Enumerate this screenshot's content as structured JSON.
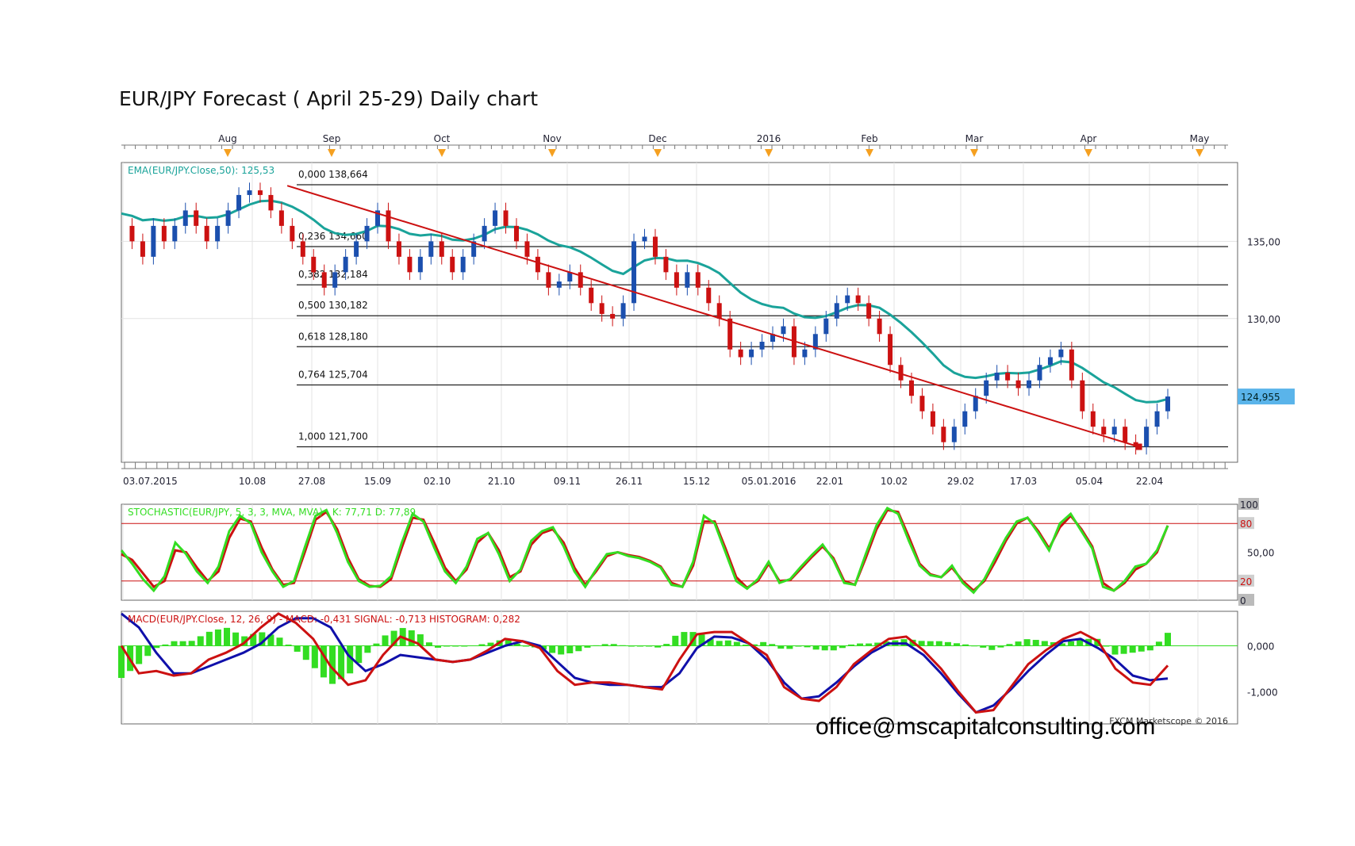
{
  "title": "EUR/JPY Forecast ( April 25-29) Daily chart",
  "email": "office@mscapitalconsulting.com",
  "credit": "FXCM Marketscope © 2016",
  "colors": {
    "ema": "#1aa39a",
    "trend": "#cc1111",
    "bull": "#1b4fae",
    "bear": "#cc1111",
    "stoch_k": "#33dd22",
    "stoch_d": "#cc1111",
    "macd": "#cc1111",
    "signal": "#1010aa",
    "hist": "#33dd22",
    "price_tag": "#5ab4ea",
    "month_marker": "#f5a020"
  },
  "chart_data": [
    {
      "type": "candlestick",
      "title": "EUR/JPY Forecast ( April 25-29) Daily chart",
      "ema_label": "EMA(EUR/JPY.Close,50): 125,53",
      "month_labels": [
        "Aug",
        "Sep",
        "Oct",
        "Nov",
        "Dec",
        "2016",
        "Feb",
        "Mar",
        "Apr",
        "May"
      ],
      "date_labels": [
        "03.07.2015",
        "10.08",
        "27.08",
        "15.09",
        "02.10",
        "21.10",
        "09.11",
        "26.11",
        "15.12",
        "05.01.2016",
        "22.01",
        "10.02",
        "29.02",
        "17.03",
        "05.04",
        "22.04"
      ],
      "y_ticks": [
        {
          "value": 135,
          "label": "135,00"
        },
        {
          "value": 130,
          "label": "130,00"
        }
      ],
      "ylim": [
        120.7,
        140.1
      ],
      "last_price": {
        "value": 124.955,
        "label": "124,955"
      },
      "fibonacci": [
        {
          "ratio": "0,000",
          "price": 138.664,
          "label": "138,664"
        },
        {
          "ratio": "0,236",
          "price": 134.66,
          "label": "134,660"
        },
        {
          "ratio": "0,382",
          "price": 132.184,
          "label": "132,184"
        },
        {
          "ratio": "0,500",
          "price": 130.182,
          "label": "130,182"
        },
        {
          "ratio": "0,618",
          "price": 128.18,
          "label": "128,180"
        },
        {
          "ratio": "0,764",
          "price": 125.704,
          "label": "125,704"
        },
        {
          "ratio": "1,000",
          "price": 121.7,
          "label": "121,700"
        }
      ],
      "trendline": {
        "from": {
          "date": "2015-08-20",
          "price": 138.6
        },
        "to": {
          "date": "2016-04-19",
          "price": 121.7
        }
      },
      "close_path": [
        136,
        135,
        134,
        136,
        135,
        136,
        137,
        136,
        135,
        136,
        137,
        138,
        138.3,
        138,
        137,
        136,
        135,
        134,
        133,
        132,
        133,
        134,
        135,
        136,
        137,
        135,
        134,
        133,
        134,
        135,
        134,
        133,
        134,
        135,
        136,
        137,
        136,
        135,
        134,
        133,
        132,
        132.4,
        133,
        132,
        131,
        130.3,
        130,
        131,
        135,
        135.3,
        134,
        133,
        132,
        133,
        132,
        131,
        130,
        128,
        127.5,
        128,
        128.5,
        129,
        129.5,
        127.5,
        128,
        129,
        130,
        131,
        131.5,
        131,
        130,
        129,
        127,
        126,
        125,
        124,
        123,
        122,
        123,
        124,
        125,
        126,
        126.5,
        126,
        125.5,
        126,
        127,
        127.5,
        128,
        126,
        124,
        123,
        122.5,
        123,
        122,
        121.7,
        123,
        124,
        124.955
      ]
    },
    {
      "type": "line",
      "title": "STOCHASTIC(EUR/JPY, 5, 3, 3, MVA, MVA) -  K: 77,71  D: 77,89",
      "y_ticks": [
        {
          "value": 100,
          "label": "100"
        },
        {
          "value": 80,
          "label": "80"
        },
        {
          "value": 50,
          "label": "50,00"
        },
        {
          "value": 20,
          "label": "20"
        },
        {
          "value": 0,
          "label": "0"
        }
      ],
      "ylim": [
        0,
        100
      ],
      "series": [
        {
          "name": "K",
          "values": [
            52,
            38,
            22,
            10,
            25,
            60,
            48,
            30,
            18,
            35,
            72,
            88,
            80,
            50,
            30,
            14,
            20,
            55,
            88,
            94,
            70,
            40,
            20,
            14,
            15,
            25,
            60,
            90,
            82,
            55,
            30,
            18,
            35,
            64,
            70,
            48,
            20,
            32,
            62,
            72,
            76,
            56,
            30,
            14,
            32,
            48,
            50,
            46,
            44,
            40,
            34,
            16,
            14,
            40,
            88,
            80,
            50,
            20,
            12,
            22,
            40,
            18,
            22,
            35,
            47,
            58,
            42,
            18,
            16,
            48,
            78,
            96,
            90,
            62,
            36,
            26,
            24,
            36,
            18,
            8,
            22,
            44,
            65,
            82,
            86,
            70,
            52,
            80,
            90,
            72,
            54,
            14,
            10,
            20,
            35,
            38,
            52,
            77.71
          ]
        },
        {
          "name": "D",
          "values": [
            48,
            42,
            28,
            14,
            20,
            52,
            50,
            34,
            20,
            30,
            65,
            85,
            82,
            55,
            32,
            16,
            18,
            50,
            84,
            92,
            74,
            44,
            22,
            15,
            14,
            22,
            55,
            86,
            84,
            60,
            34,
            20,
            32,
            60,
            70,
            52,
            24,
            30,
            58,
            70,
            74,
            60,
            34,
            16,
            30,
            46,
            50,
            47,
            45,
            41,
            35,
            18,
            14,
            36,
            82,
            82,
            54,
            24,
            13,
            20,
            38,
            20,
            21,
            33,
            45,
            56,
            44,
            20,
            16,
            44,
            74,
            94,
            92,
            66,
            38,
            27,
            24,
            34,
            20,
            10,
            20,
            40,
            62,
            80,
            86,
            72,
            54,
            76,
            88,
            74,
            56,
            18,
            10,
            18,
            32,
            38,
            50,
            77.89
          ]
        }
      ]
    },
    {
      "type": "line",
      "title": "MACD(EUR/JPY.Close, 12, 26, 9) -  MACD: -0,431  SIGNAL: -0,713  HISTOGRAM: 0,282",
      "y_ticks": [
        {
          "value": 0,
          "label": "0,000"
        },
        {
          "value": -1,
          "label": "-1,000"
        }
      ],
      "ylim": [
        -1.7,
        0.75
      ],
      "series": [
        {
          "name": "MACD",
          "values": [
            0,
            -0.6,
            -0.55,
            -0.65,
            -0.6,
            -0.3,
            -0.15,
            0.05,
            0.4,
            0.7,
            0.5,
            0.15,
            -0.45,
            -0.85,
            -0.75,
            -0.2,
            0.2,
            0.05,
            -0.3,
            -0.35,
            -0.3,
            -0.1,
            0.15,
            0.1,
            -0.05,
            -0.55,
            -0.85,
            -0.8,
            -0.8,
            -0.85,
            -0.9,
            -0.95,
            -0.3,
            0.25,
            0.3,
            0.3,
            0.05,
            -0.2,
            -0.9,
            -1.15,
            -1.2,
            -0.9,
            -0.4,
            -0.1,
            0.15,
            0.2,
            -0.1,
            -0.5,
            -1,
            -1.45,
            -1.4,
            -0.9,
            -0.4,
            -0.1,
            0.15,
            0.3,
            0.1,
            -0.5,
            -0.8,
            -0.85,
            -0.431
          ]
        },
        {
          "name": "SIGNAL",
          "values": [
            0.7,
            0.4,
            -0.15,
            -0.6,
            -0.6,
            -0.45,
            -0.3,
            -0.15,
            0.05,
            0.4,
            0.6,
            0.6,
            0.4,
            -0.2,
            -0.55,
            -0.4,
            -0.2,
            -0.25,
            -0.3,
            -0.35,
            -0.3,
            -0.15,
            0,
            0.1,
            0,
            -0.35,
            -0.7,
            -0.8,
            -0.85,
            -0.85,
            -0.9,
            -0.9,
            -0.6,
            -0.05,
            0.2,
            0.18,
            0.05,
            -0.3,
            -0.8,
            -1.15,
            -1.1,
            -0.8,
            -0.45,
            -0.15,
            0.05,
            0.05,
            -0.2,
            -0.6,
            -1.05,
            -1.45,
            -1.3,
            -0.95,
            -0.55,
            -0.2,
            0.1,
            0.15,
            -0.05,
            -0.3,
            -0.65,
            -0.75,
            -0.713
          ]
        },
        {
          "name": "HISTOGRAM",
          "values": [
            -0.7,
            -0.4,
            -0.05,
            0.1,
            0.1,
            0.3,
            0.4,
            0.2,
            0.3,
            0.2,
            -0.1,
            -0.45,
            -0.85,
            -0.65,
            -0.2,
            0.2,
            0.4,
            0.3,
            -0.05,
            0,
            0,
            0.05,
            0.15,
            0,
            -0.05,
            -0.2,
            -0.15,
            0,
            0.05,
            0,
            0,
            -0.05,
            0.3,
            0.3,
            0.1,
            0.12,
            0,
            0.1,
            -0.1,
            0,
            -0.1,
            -0.1,
            0.05,
            0.05,
            0.1,
            0.15,
            0.1,
            0.1,
            0.05,
            0,
            -0.1,
            0.05,
            0.15,
            0.1,
            0.05,
            0.15,
            0.15,
            -0.2,
            -0.15,
            -0.1,
            0.282
          ]
        }
      ]
    }
  ]
}
